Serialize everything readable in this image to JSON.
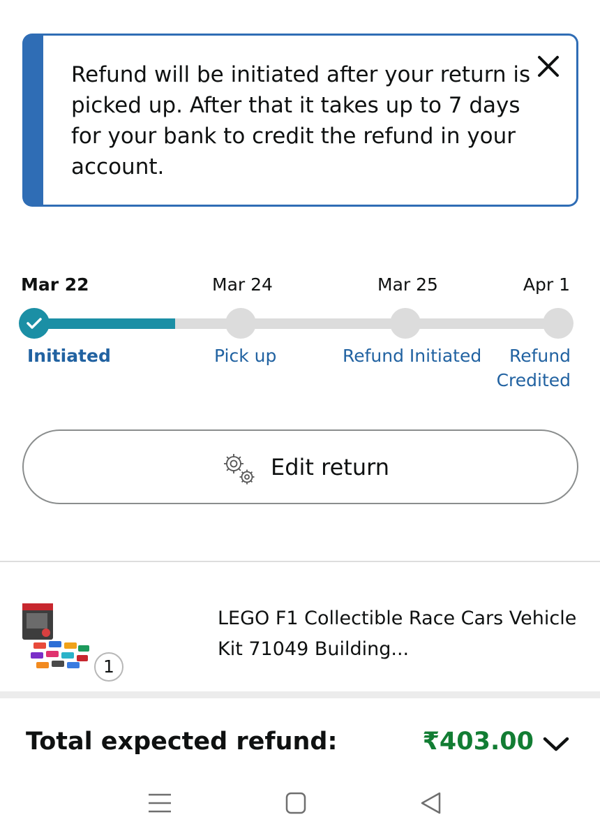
{
  "banner": {
    "message": "Refund will be initiated after your return is picked up. After that it takes up to 7 days for your bank to credit the refund in your account.",
    "close_icon": "close-icon"
  },
  "tracker": {
    "progress": 0.27,
    "steps": [
      {
        "date": "Mar 22",
        "label": "Initiated",
        "status": "done"
      },
      {
        "date": "Mar 24",
        "label": "Pick up",
        "status": "pending"
      },
      {
        "date": "Mar 25",
        "label": "Refund Initiated",
        "status": "pending"
      },
      {
        "date": "Apr 1",
        "label": "Refund Credited",
        "status": "pending"
      }
    ]
  },
  "edit_button": {
    "label": "Edit return",
    "icon": "gears-icon"
  },
  "product": {
    "title": "LEGO F1 Collectible Race Cars Vehicle Kit 71049 Building...",
    "quantity": "1"
  },
  "refund": {
    "label": "Total expected refund:",
    "amount": "₹403.00"
  },
  "navbar": {
    "icons": [
      "menu-icon",
      "home-icon",
      "back-icon"
    ]
  },
  "colors": {
    "banner_accent": "#2f6db5",
    "progress": "#1b8fa5",
    "link": "#2162a1",
    "amount": "#127d33"
  }
}
